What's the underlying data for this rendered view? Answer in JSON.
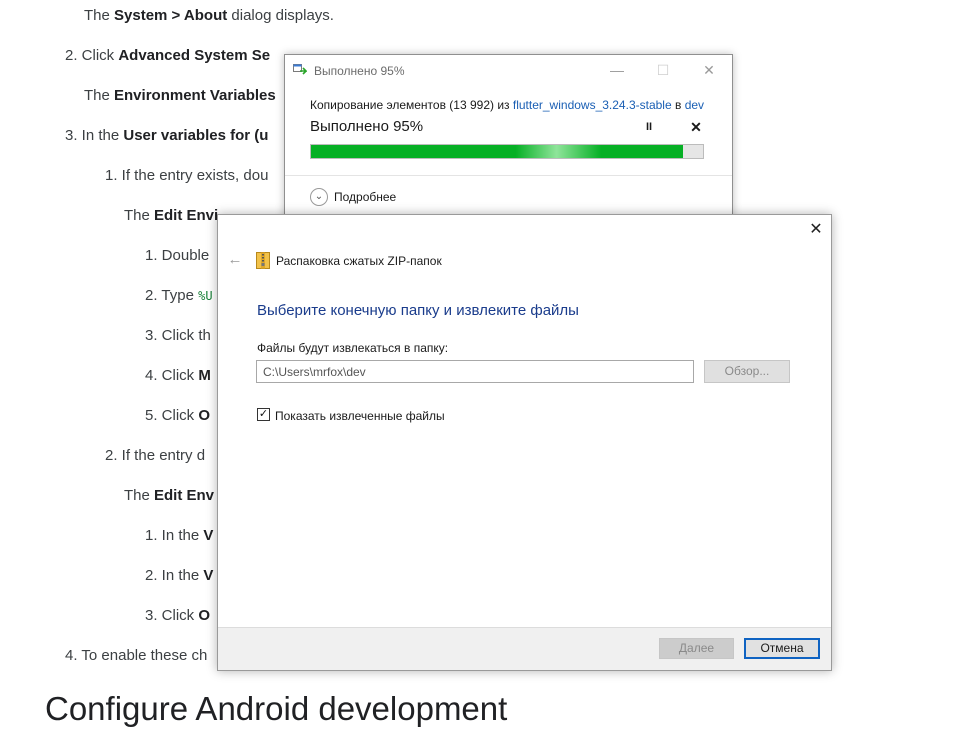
{
  "doc": {
    "line1": {
      "pre": "The ",
      "b1": "System > About",
      "post": " dialog displays."
    },
    "step2": {
      "pre": "2. Click ",
      "b1": "Advanced System Se"
    },
    "line3": {
      "pre": "The ",
      "b1": "Environment Variables"
    },
    "step3": {
      "pre": "3. In the ",
      "b1": "User variables for (u"
    },
    "sub1": {
      "text": "1. If the entry exists, dou"
    },
    "line5": {
      "pre": "The ",
      "b1": "Edit Envi"
    },
    "s1": "1. Double",
    "s2": {
      "pre": "2. Type ",
      "code": "%U"
    },
    "s3": "3. Click th",
    "s4": {
      "pre": "4. Click ",
      "b1": "M"
    },
    "s5": {
      "pre": "5. Click ",
      "b1": "O"
    },
    "sub2": "2. If the entry d",
    "line12": {
      "pre": "The ",
      "b1": "Edit Env"
    },
    "t1": {
      "pre": "1. In the ",
      "b1": "V"
    },
    "t2": {
      "pre": "2. In the ",
      "b1": "V"
    },
    "t3": {
      "pre": "3. Click ",
      "b1": "O"
    },
    "step4": "4. To enable these ch",
    "heading": "Configure Android development"
  },
  "copy_dialog": {
    "title": "Выполнено 95%",
    "desc_pre": "Копирование элементов (13 992) из ",
    "src_link": "flutter_windows_3.24.3-stable",
    "desc_mid": " в ",
    "dst_link": "dev",
    "status": "Выполнено 95%",
    "progress_percent": 95,
    "pause_symbol": "II",
    "stop_symbol": "✕",
    "more_label": "Подробнее",
    "minimize_symbol": "—",
    "maximize_symbol": "☐",
    "close_symbol": "✕"
  },
  "zip_wizard": {
    "header_title": "Распаковка сжатых ZIP-папок",
    "heading": "Выберите конечную папку и извлеките файлы",
    "dest_label": "Файлы будут извлекаться в папку:",
    "dest_value": "C:\\Users\\mrfox\\dev",
    "browse_label": "Обзор...",
    "show_files_label": "Показать извлеченные файлы",
    "show_files_checked": true,
    "next_label": "Далее",
    "cancel_label": "Отмена",
    "back_symbol": "←",
    "close_symbol": "✕"
  }
}
